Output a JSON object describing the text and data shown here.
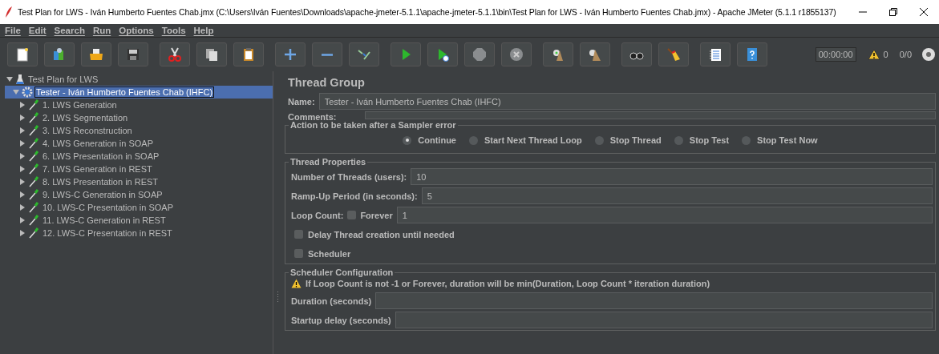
{
  "window": {
    "title": "Test Plan for LWS - Iván Humberto Fuentes Chab.jmx (C:\\Users\\Iván Fuentes\\Downloads\\apache-jmeter-5.1.1\\apache-jmeter-5.1.1\\bin\\Test Plan for LWS - Iván Humberto Fuentes Chab.jmx) - Apache JMeter (5.1.1 r1855137)"
  },
  "menu": [
    "File",
    "Edit",
    "Search",
    "Run",
    "Options",
    "Tools",
    "Help"
  ],
  "toolbar": {
    "timer": "00:00:00",
    "warnings": "0",
    "threads": "0/0"
  },
  "tree": [
    {
      "label": "Test Plan for LWS",
      "kind": "plan",
      "expanded": true,
      "selected": false,
      "children": [
        {
          "label": "Tester - Iván Humberto Fuentes Chab (IHFC)",
          "kind": "group",
          "expanded": true,
          "selected": true,
          "children": [
            {
              "label": "1. LWS Generation",
              "kind": "sampler",
              "expanded": false,
              "selected": false
            },
            {
              "label": "2. LWS Segmentation",
              "kind": "sampler",
              "expanded": false,
              "selected": false
            },
            {
              "label": "3. LWS Reconstruction",
              "kind": "sampler",
              "expanded": false,
              "selected": false
            },
            {
              "label": "4. LWS Generation in SOAP",
              "kind": "sampler",
              "expanded": false,
              "selected": false
            },
            {
              "label": "6. LWS Presentation in SOAP",
              "kind": "sampler",
              "expanded": false,
              "selected": false
            },
            {
              "label": "7. LWS Generation in REST",
              "kind": "sampler",
              "expanded": false,
              "selected": false
            },
            {
              "label": "8. LWS Presentation in REST",
              "kind": "sampler",
              "expanded": false,
              "selected": false
            },
            {
              "label": "9. LWS-C Generation in SOAP",
              "kind": "sampler",
              "expanded": false,
              "selected": false
            },
            {
              "label": "10. LWS-C Presentation in SOAP",
              "kind": "sampler",
              "expanded": false,
              "selected": false
            },
            {
              "label": "11. LWS-C Generation in REST",
              "kind": "sampler",
              "expanded": false,
              "selected": false
            },
            {
              "label": "12. LWS-C Presentation in REST",
              "kind": "sampler",
              "expanded": false,
              "selected": false
            }
          ]
        }
      ]
    }
  ],
  "panel": {
    "title": "Thread Group",
    "name": {
      "label": "Name:",
      "value": "Tester - Iván Humberto Fuentes Chab (IHFC)"
    },
    "comments": {
      "label": "Comments:"
    },
    "error_action": {
      "legend": "Action to be taken after a Sampler error",
      "options": [
        {
          "label": "Continue",
          "selected": true
        },
        {
          "label": "Start Next Thread Loop",
          "selected": false
        },
        {
          "label": "Stop Thread",
          "selected": false
        },
        {
          "label": "Stop Test",
          "selected": false
        },
        {
          "label": "Stop Test Now",
          "selected": false
        }
      ]
    },
    "thread_properties": {
      "legend": "Thread Properties",
      "threads": {
        "label": "Number of Threads (users):",
        "value": "10"
      },
      "ramp_up": {
        "label": "Ramp-Up Period (in seconds):",
        "value": "5"
      },
      "loop_count": {
        "label": "Loop Count:",
        "forever_label": "Forever",
        "forever_checked": false,
        "value": "1"
      },
      "delay": {
        "label": "Delay Thread creation until needed",
        "checked": false
      },
      "scheduler": {
        "label": "Scheduler",
        "checked": false
      }
    },
    "scheduler_config": {
      "legend": "Scheduler Configuration",
      "warning": "If Loop Count is not -1 or Forever, duration will be min(Duration, Loop Count * iteration duration)",
      "duration": {
        "label": "Duration (seconds)"
      },
      "startup_delay": {
        "label": "Startup delay (seconds)"
      }
    }
  }
}
